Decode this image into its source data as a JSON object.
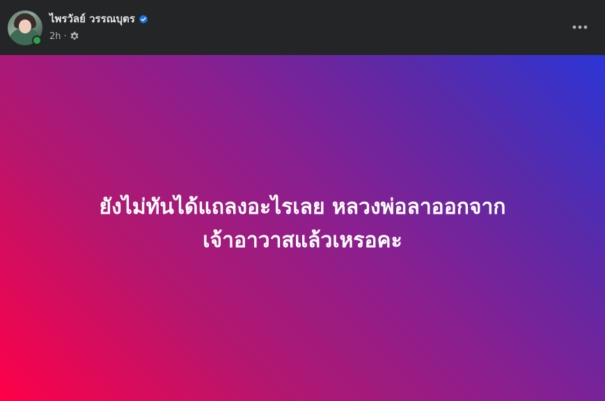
{
  "post": {
    "author_name": "ไพรวัลย์ วรรณบุตร",
    "verified": true,
    "time": "2h",
    "separator": "·",
    "privacy_icon": "gear-icon",
    "more_icon": "more-horizontal-icon",
    "online_status": "online",
    "text_lines": [
      "ยังไม่ทันได้แถลงอะไรเลย หลวงพ่อลาออกจาก",
      "เจ้าอาวาสแล้วเหรอคะ"
    ]
  },
  "colors": {
    "background": "#242526",
    "name_text": "#e4e6eb",
    "meta_text": "#b0b3b8",
    "verified_badge": "#1b74e4",
    "online_dot": "#31a24c",
    "gradient_start": "#ff0048",
    "gradient_end": "#2c35d6"
  }
}
